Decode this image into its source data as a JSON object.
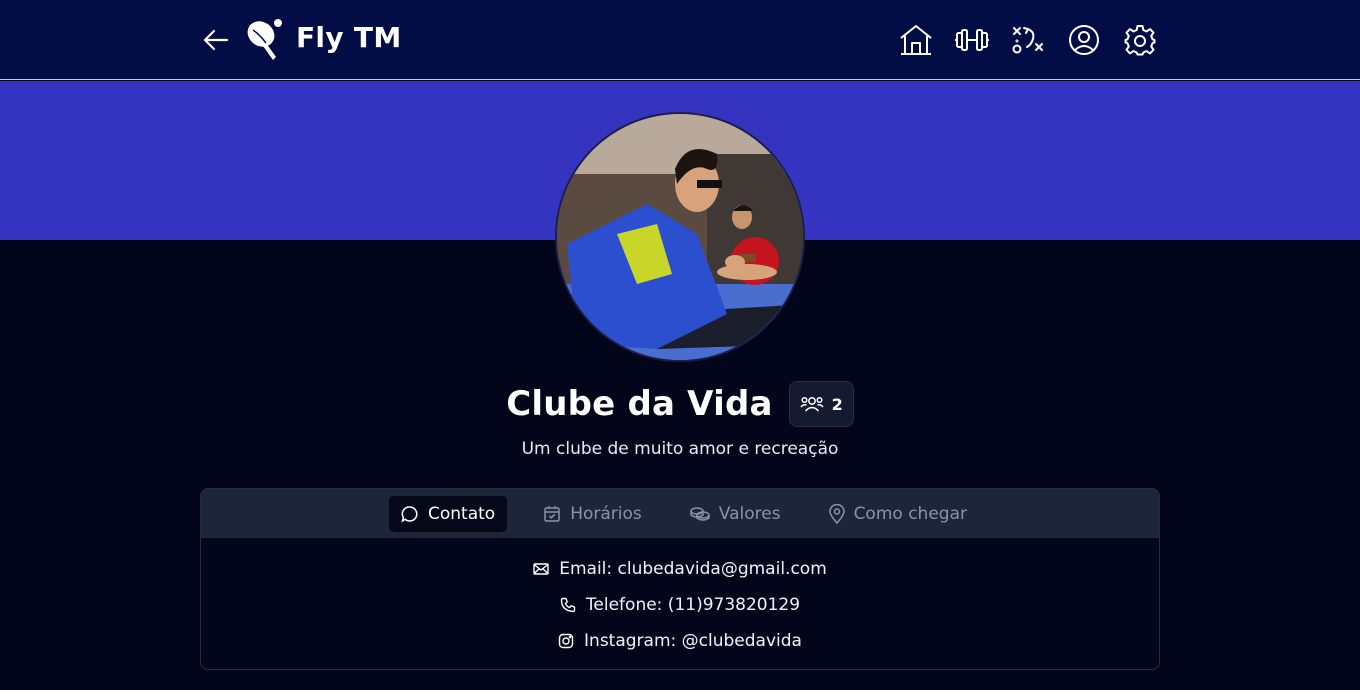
{
  "header": {
    "brand": "Fly TM",
    "nav": [
      {
        "icon": "home-icon"
      },
      {
        "icon": "dumbbell-icon"
      },
      {
        "icon": "strategy-icon"
      },
      {
        "icon": "user-icon"
      },
      {
        "icon": "gear-icon"
      }
    ]
  },
  "club": {
    "name": "Clube da Vida",
    "members": "2",
    "description": "Um clube de muito amor e recreação"
  },
  "tabs": [
    {
      "label": "Contato",
      "icon": "chat-icon",
      "active": true
    },
    {
      "label": "Horários",
      "icon": "calendar-icon",
      "active": false
    },
    {
      "label": "Valores",
      "icon": "coins-icon",
      "active": false
    },
    {
      "label": "Como chegar",
      "icon": "map-pin-icon",
      "active": false
    }
  ],
  "contact": {
    "email": "Email: clubedavida@gmail.com",
    "phone": "Telefone: (11)973820129",
    "instagram": "Instagram: @clubedavida"
  },
  "colors": {
    "header_bg": "#020c45",
    "banner": "#3534c0",
    "page_bg": "#03061a",
    "tabs_bg": "#1d2639"
  }
}
